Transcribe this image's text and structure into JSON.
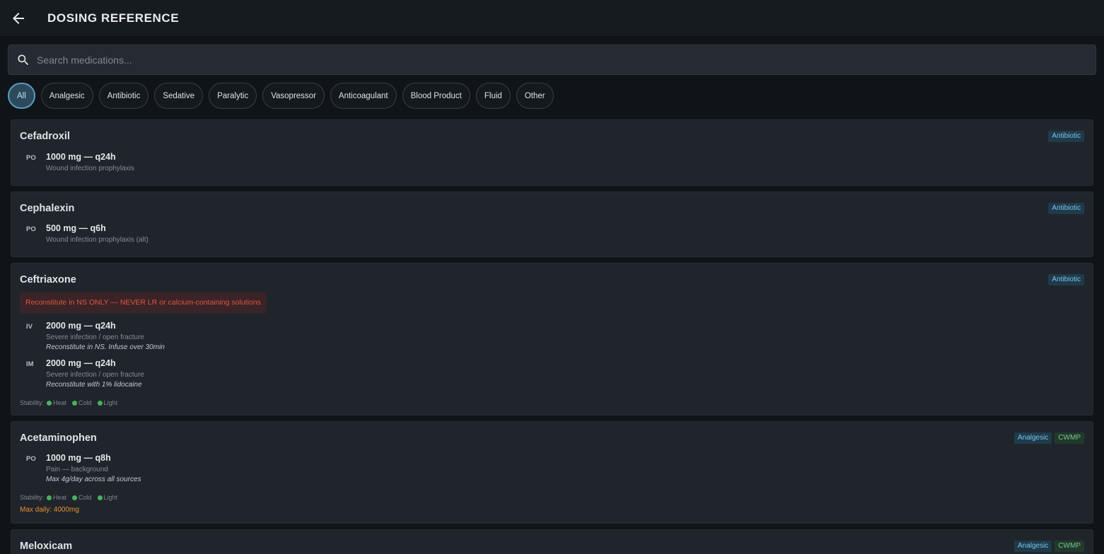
{
  "header": {
    "title": "DOSING REFERENCE"
  },
  "search": {
    "placeholder": "Search medications..."
  },
  "filters": [
    "All",
    "Analgesic",
    "Antibiotic",
    "Sedative",
    "Paralytic",
    "Vasopressor",
    "Anticoagulant",
    "Blood Product",
    "Fluid",
    "Other"
  ],
  "active_filter": "All",
  "stability_label": "Stability:",
  "medications": [
    {
      "name": "Cefadroxil",
      "tags": [
        "Antibiotic"
      ],
      "doses": [
        {
          "route": "PO",
          "amount": "1000 mg — q24h",
          "indication": "Wound infection prophylaxis"
        }
      ]
    },
    {
      "name": "Cephalexin",
      "tags": [
        "Antibiotic"
      ],
      "doses": [
        {
          "route": "PO",
          "amount": "500 mg — q6h",
          "indication": "Wound infection prophylaxis (alt)"
        }
      ]
    },
    {
      "name": "Ceftriaxone",
      "tags": [
        "Antibiotic"
      ],
      "warning": "Reconstitute in NS ONLY — NEVER LR or calcium-containing solutions",
      "doses": [
        {
          "route": "IV",
          "amount": "2000 mg — q24h",
          "indication": "Severe infection / open fracture",
          "note": "Reconstitute in NS. Infuse over 30min"
        },
        {
          "route": "IM",
          "amount": "2000 mg — q24h",
          "indication": "Severe infection / open fracture",
          "note": "Reconstitute with 1% lidocaine"
        }
      ],
      "stability": [
        "Heat",
        "Cold",
        "Light"
      ]
    },
    {
      "name": "Acetaminophen",
      "tags": [
        "Analgesic",
        "CWMP"
      ],
      "doses": [
        {
          "route": "PO",
          "amount": "1000 mg — q8h",
          "indication": "Pain — background",
          "note": "Max 4g/day across all sources"
        }
      ],
      "stability": [
        "Heat",
        "Cold",
        "Light"
      ],
      "max_daily": "Max daily: 4000mg"
    },
    {
      "name": "Meloxicam",
      "tags": [
        "Analgesic",
        "CWMP"
      ]
    }
  ],
  "colors": {
    "accent": "#5d9cbf",
    "warning": "#e0563e",
    "stable": "#49b35c",
    "max_daily": "#e8912e"
  }
}
